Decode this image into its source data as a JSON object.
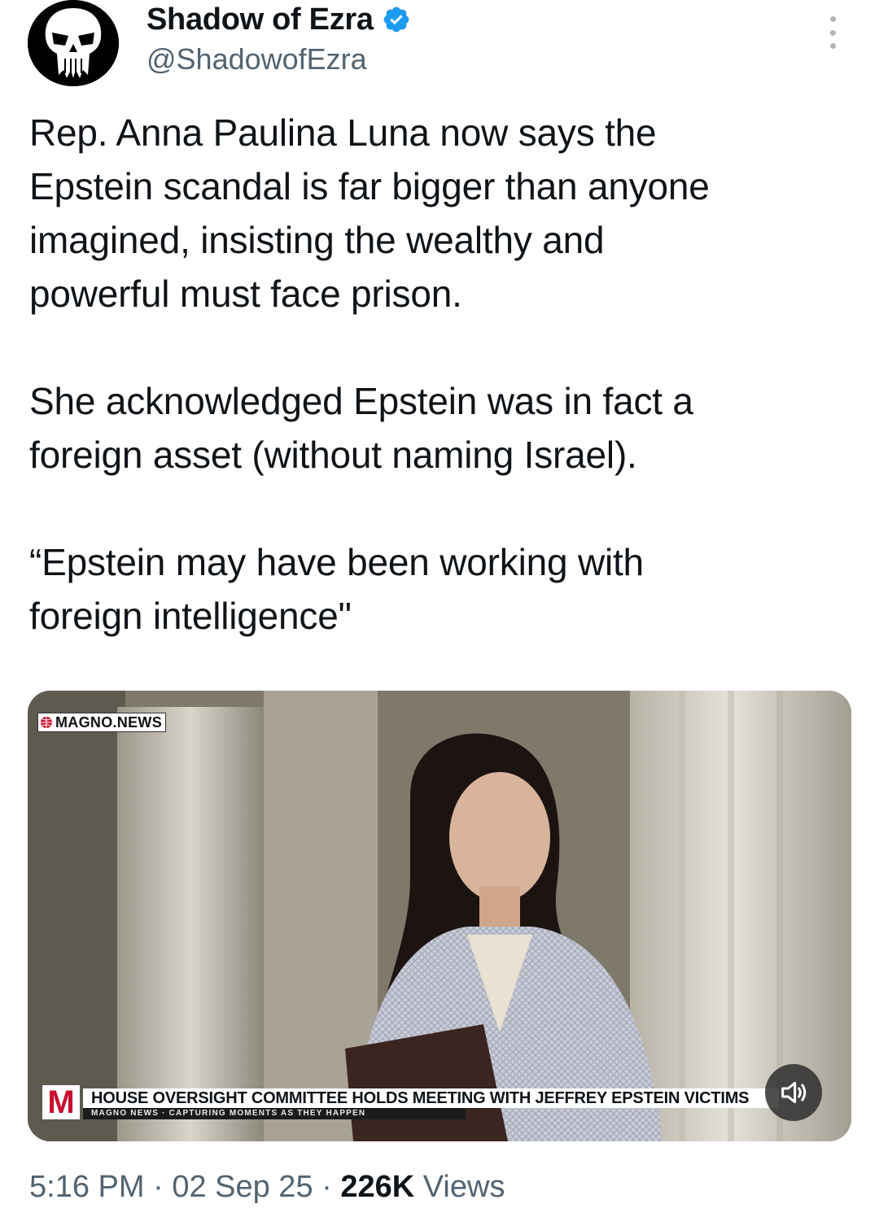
{
  "author": {
    "display_name": "Shadow of Ezra",
    "handle": "@ShadowofEzra",
    "verified": true,
    "avatar_icon": "skull-avatar-icon",
    "verified_color": "#1d9bf0"
  },
  "more_menu_icon": "more-vertical-icon",
  "tweet": {
    "text": "Rep. Anna Paulina Luna now says the\nEpstein scandal is far bigger than anyone\nimagined, insisting the wealthy and\npowerful must face prison.\n\nShe acknowledged Epstein was in fact a\nforeign asset (without naming Israel).\n\n“Epstein may have been working with\nforeign intelligence\""
  },
  "media": {
    "watermark": "MAGNO.NEWS",
    "lower_third_logo": "M",
    "headline": "HOUSE OVERSIGHT COMMITTEE HOLDS MEETING WITH JEFFREY EPSTEIN VICTIMS",
    "subheadline": "MAGNO NEWS · CAPTURING MOMENTS AS THEY HAPPEN",
    "sound_icon": "speaker-muted-icon"
  },
  "meta": {
    "time": "5:16 PM",
    "separator": "·",
    "date": "02 Sep 25",
    "views_count": "226K",
    "views_label": "Views"
  }
}
